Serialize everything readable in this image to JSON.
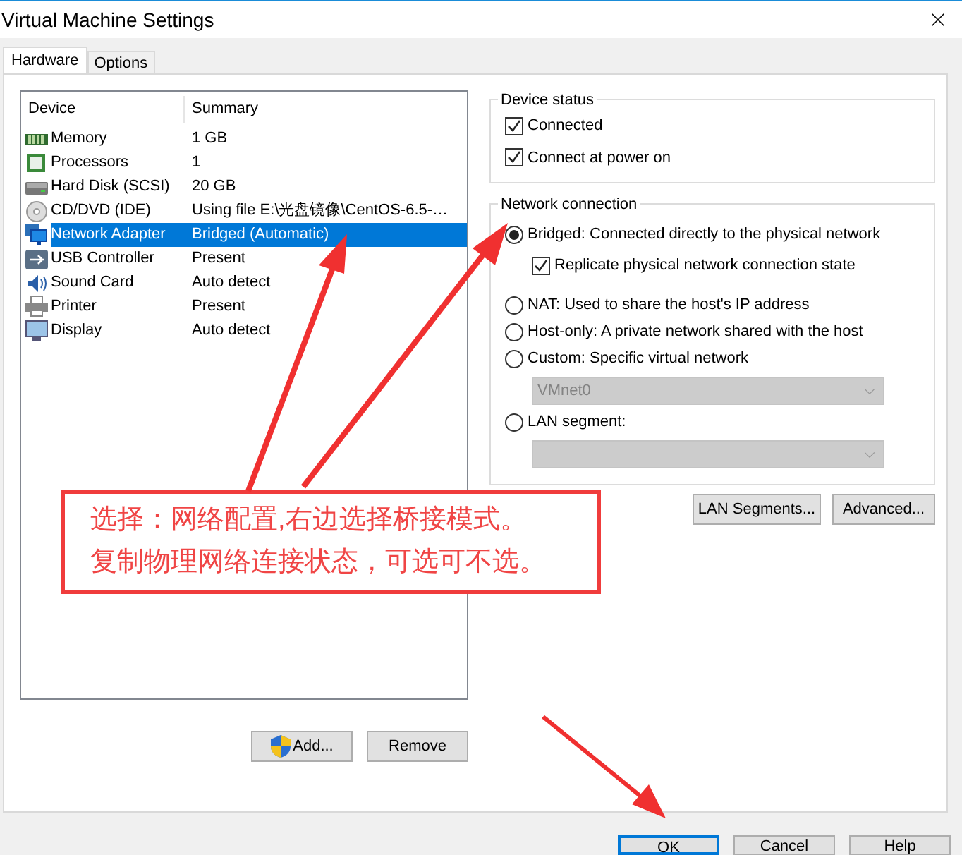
{
  "window": {
    "title": "Virtual Machine Settings"
  },
  "tabs": [
    {
      "label": "Hardware",
      "selected": true
    },
    {
      "label": "Options",
      "selected": false
    }
  ],
  "device_table": {
    "columns": [
      "Device",
      "Summary"
    ],
    "rows": [
      {
        "device": "Memory",
        "summary": "1 GB",
        "selected": false
      },
      {
        "device": "Processors",
        "summary": "1",
        "selected": false
      },
      {
        "device": "Hard Disk (SCSI)",
        "summary": "20 GB",
        "selected": false
      },
      {
        "device": "CD/DVD (IDE)",
        "summary": "Using file E:\\光盘镜像\\CentOS-6.5-…",
        "selected": false
      },
      {
        "device": "Network Adapter",
        "summary": "Bridged (Automatic)",
        "selected": true
      },
      {
        "device": "USB Controller",
        "summary": "Present",
        "selected": false
      },
      {
        "device": "Sound Card",
        "summary": "Auto detect",
        "selected": false
      },
      {
        "device": "Printer",
        "summary": "Present",
        "selected": false
      },
      {
        "device": "Display",
        "summary": "Auto detect",
        "selected": false
      }
    ]
  },
  "table_buttons": [
    "Add...",
    "Remove"
  ],
  "device_status": {
    "title": "Device status",
    "options": [
      {
        "label": "Connected",
        "checked": true
      },
      {
        "label": "Connect at power on",
        "checked": true
      }
    ]
  },
  "network_connection": {
    "title": "Network connection",
    "options": [
      {
        "kind": "radio",
        "label": "Bridged: Connected directly to the physical network",
        "selected": true
      },
      {
        "kind": "checkbox",
        "label": "Replicate physical network connection state",
        "checked": true
      },
      {
        "kind": "radio",
        "label": "NAT: Used to share the host's IP address",
        "selected": false
      },
      {
        "kind": "radio",
        "label": "Host-only: A private network shared with the host",
        "selected": false
      },
      {
        "kind": "radio",
        "label": "Custom: Specific virtual network",
        "selected": false
      },
      {
        "kind": "dropdown",
        "value": "VMnet0",
        "disabled": true
      },
      {
        "kind": "radio",
        "label": "LAN segment:",
        "selected": false
      },
      {
        "kind": "dropdown",
        "disabled": true
      }
    ]
  },
  "network_buttons": [
    "LAN Segments...",
    "Advanced..."
  ],
  "annotation": {
    "lines": [
      "选择：网络配置,右边选择桥接模式。",
      "复制物理网络连接状态，可选可不选。"
    ]
  },
  "dialog_buttons": [
    {
      "label": "OK",
      "default": true
    },
    {
      "label": "Cancel",
      "default": false
    },
    {
      "label": "Help",
      "default": false
    }
  ]
}
